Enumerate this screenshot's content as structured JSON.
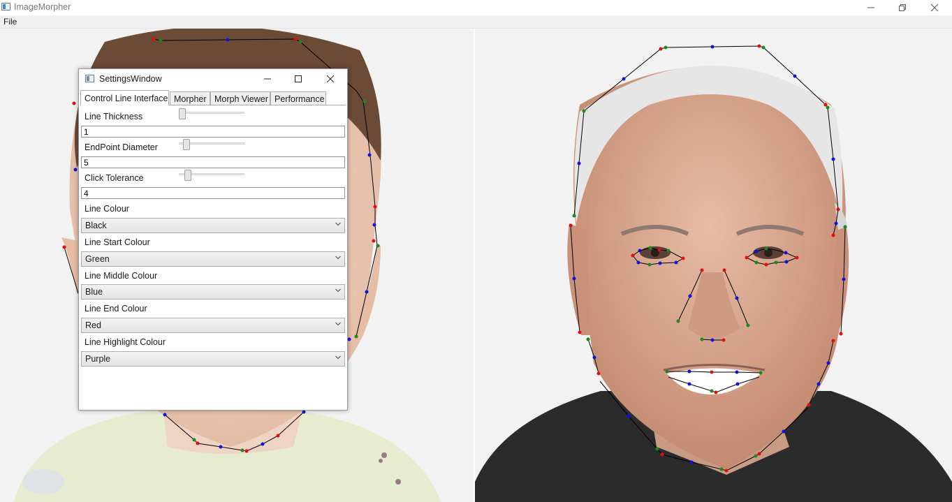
{
  "window": {
    "title": "ImageMorpher",
    "controls": {
      "minimize": "minimize",
      "maximize": "restore",
      "close": "close"
    }
  },
  "menu": {
    "items": [
      "File"
    ]
  },
  "settings_window": {
    "title": "SettingsWindow",
    "tabs": [
      {
        "label": "Control Line Interface",
        "active": true
      },
      {
        "label": "Morpher",
        "active": false
      },
      {
        "label": "Morph Viewer",
        "active": false
      },
      {
        "label": "Performance",
        "active": false
      }
    ],
    "line_thickness": {
      "label": "Line Thickness",
      "value": "1"
    },
    "endpoint_diameter": {
      "label": "EndPoint Diameter",
      "value": "5"
    },
    "click_tolerance": {
      "label": "Click Tolerance",
      "value": "4"
    },
    "line_colour": {
      "label": "Line Colour",
      "selected": "Black"
    },
    "line_start_colour": {
      "label": "Line Start Colour",
      "selected": "Green"
    },
    "line_middle_colour": {
      "label": "Line Middle Colour",
      "selected": "Blue"
    },
    "line_end_colour": {
      "label": "Line End Colour",
      "selected": "Red"
    },
    "line_highlight_colour": {
      "label": "Line Highlight Colour",
      "selected": "Purple"
    }
  },
  "colors": {
    "line": "#000000",
    "start": "#1a8a1a",
    "middle": "#1010e0",
    "end": "#e01010",
    "skin_light": "#f1d2c0",
    "skin_old": "#d9a58d",
    "hair_young": "#6b4a36",
    "hair_old": "#e6e6e6",
    "shirt_young": "#e8ecd2",
    "shirt_old": "#2b2b2b"
  },
  "icons": {
    "app": "window-app-icon",
    "tab_dropdown": "chevron-down-icon"
  }
}
